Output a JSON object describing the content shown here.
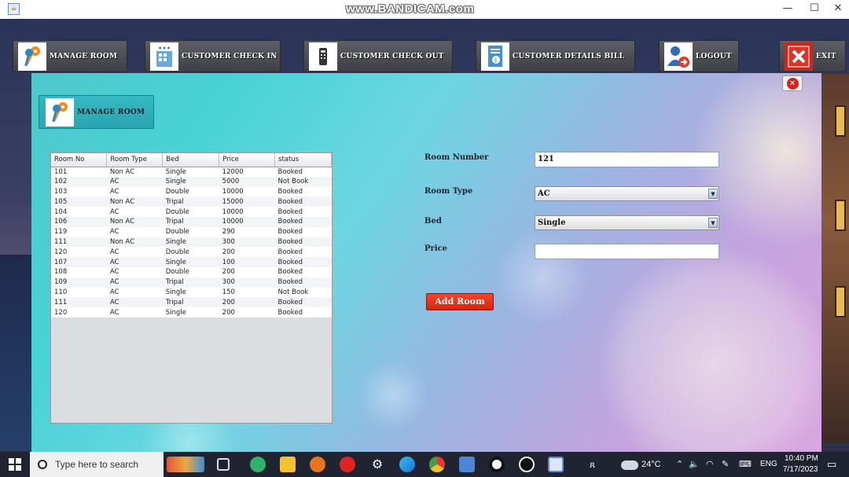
{
  "window": {
    "watermark": "www.BANDICAM.com",
    "minimize": "—",
    "maximize": "☐",
    "close": "✕"
  },
  "toolbar": {
    "buttons": [
      {
        "label": "MANAGE ROOM",
        "icon": "keys-icon"
      },
      {
        "label": "CUSTOMER CHECK IN",
        "icon": "hotel-icon"
      },
      {
        "label": "CUSTOMER CHECK OUT",
        "icon": "checkout-icon"
      },
      {
        "label": "CUSTOMER DETAILS BILL",
        "icon": "bill-icon"
      },
      {
        "label": "LOGOUT",
        "icon": "logout-icon"
      },
      {
        "label": "EXIT",
        "icon": "exit-icon"
      }
    ]
  },
  "panel": {
    "header_label": "MANAGE ROOM",
    "close_glyph": "✕"
  },
  "table": {
    "columns": [
      "Room No",
      "Room Type",
      "Bed",
      "Price",
      "status"
    ],
    "rows": [
      [
        "101",
        "Non AC",
        "Single",
        "12000",
        "Booked"
      ],
      [
        "102",
        "AC",
        "Single",
        "5000",
        "Not Book"
      ],
      [
        "103",
        "AC",
        "Double",
        "10000",
        "Booked"
      ],
      [
        "105",
        "Non AC",
        "Tripal",
        "15000",
        "Booked"
      ],
      [
        "104",
        "AC",
        "Double",
        "10000",
        "Booked"
      ],
      [
        "106",
        "Non AC",
        "Tripal",
        "10000",
        "Booked"
      ],
      [
        "119",
        "AC",
        "Double",
        "290",
        "Booked"
      ],
      [
        "111",
        "Non AC",
        "Single",
        "300",
        "Booked"
      ],
      [
        "120",
        "AC",
        "Double",
        "200",
        "Booked"
      ],
      [
        "107",
        "AC",
        "Single",
        "100",
        "Booked"
      ],
      [
        "108",
        "AC",
        "Double",
        "200",
        "Booked"
      ],
      [
        "109",
        "AC",
        "Tripal",
        "300",
        "Booked"
      ],
      [
        "110",
        "AC",
        "Single",
        "150",
        "Not Book"
      ],
      [
        "111",
        "AC",
        "Tripal",
        "200",
        "Booked"
      ],
      [
        "120",
        "AC",
        "Single",
        "200",
        "Booked"
      ]
    ]
  },
  "form": {
    "room_number_label": "Room Number",
    "room_number_value": "121",
    "room_type_label": "Room Type",
    "room_type_value": "AC",
    "bed_label": "Bed",
    "bed_value": "Single",
    "price_label": "Price",
    "price_value": "",
    "add_button": "Add Room"
  },
  "taskbar": {
    "search_placeholder": "Type here to search",
    "weather": "24°C",
    "language": "ENG",
    "time": "10:40 PM",
    "date": "7/17/2023"
  }
}
